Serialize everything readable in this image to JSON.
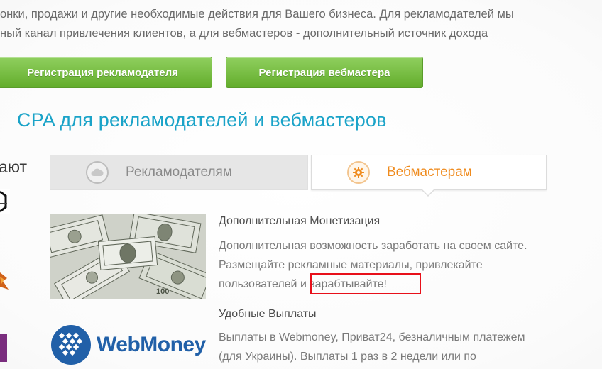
{
  "intro": {
    "line1": "онки, продажи и другие необходимые действия для Вашего бизнеса. Для рекламодателей мы",
    "line2": "ный канал привлечения клиентов, а для вебмастеров - дополнительный источник дохода"
  },
  "buttons": {
    "advertiser_register": "Регистрация рекламодателя",
    "webmaster_register": "Регистрация вебмастера"
  },
  "section_title": "CPA для рекламодателей и вебмастеров",
  "left_label": "ают",
  "tabs": [
    {
      "label": "Рекламодателям",
      "icon": "cloud-icon",
      "active": false
    },
    {
      "label": "Вебмастерам",
      "icon": "gear-icon",
      "active": true
    }
  ],
  "items": [
    {
      "title": "Дополнительная Монетизация",
      "lines": [
        "Дополнительная возможность заработать на своем сайте.",
        "Размещайте рекламные материалы, привлекайте",
        "пользователей и зарабтывайте!"
      ],
      "image": "money-image"
    },
    {
      "title": "Удобные Выплаты",
      "lines": [
        "Выплаты в Webmoney, Приват24, безналичным платежем",
        "(для Украины). Выплаты 1 раз в 2 недели или по"
      ],
      "image": "webmoney-logo"
    }
  ],
  "webmoney_text": "WebMoney",
  "colors": {
    "accent_blue": "#1aa3c8",
    "button_green": "#6fb836",
    "active_tab_orange": "#ef8b1e",
    "highlight_red": "#e8101a",
    "webmoney_blue": "#2160a8"
  }
}
